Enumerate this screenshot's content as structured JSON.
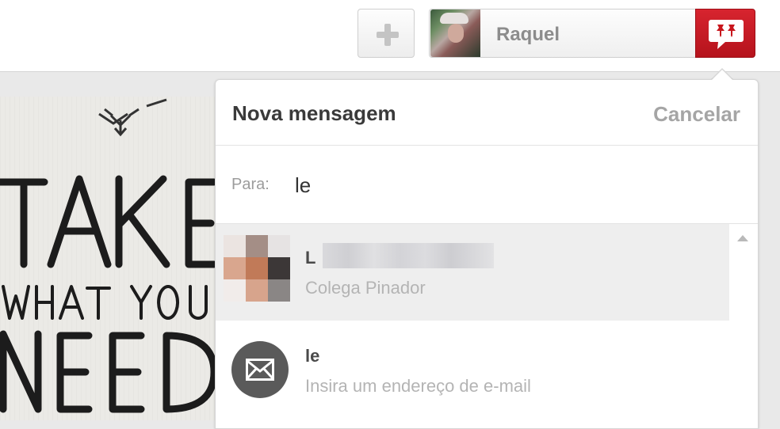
{
  "header": {
    "add_icon": "plus-icon",
    "user": {
      "name": "Raquel"
    },
    "messages_icon": "pinner-message-icon",
    "accent_color": "#c8161d"
  },
  "pin_image": {
    "lines": [
      "TAKE",
      "WHAT YOU",
      "NEED"
    ]
  },
  "popup": {
    "title": "Nova mensagem",
    "cancel_label": "Cancelar",
    "to_label": "Para:",
    "to_value": "le",
    "results": [
      {
        "name_initial": "L",
        "subtitle": "Colega Pinador",
        "selected": true
      },
      {
        "name": "le",
        "subtitle": "Insira um endereço de e-mail",
        "icon": "mail-icon"
      }
    ]
  }
}
